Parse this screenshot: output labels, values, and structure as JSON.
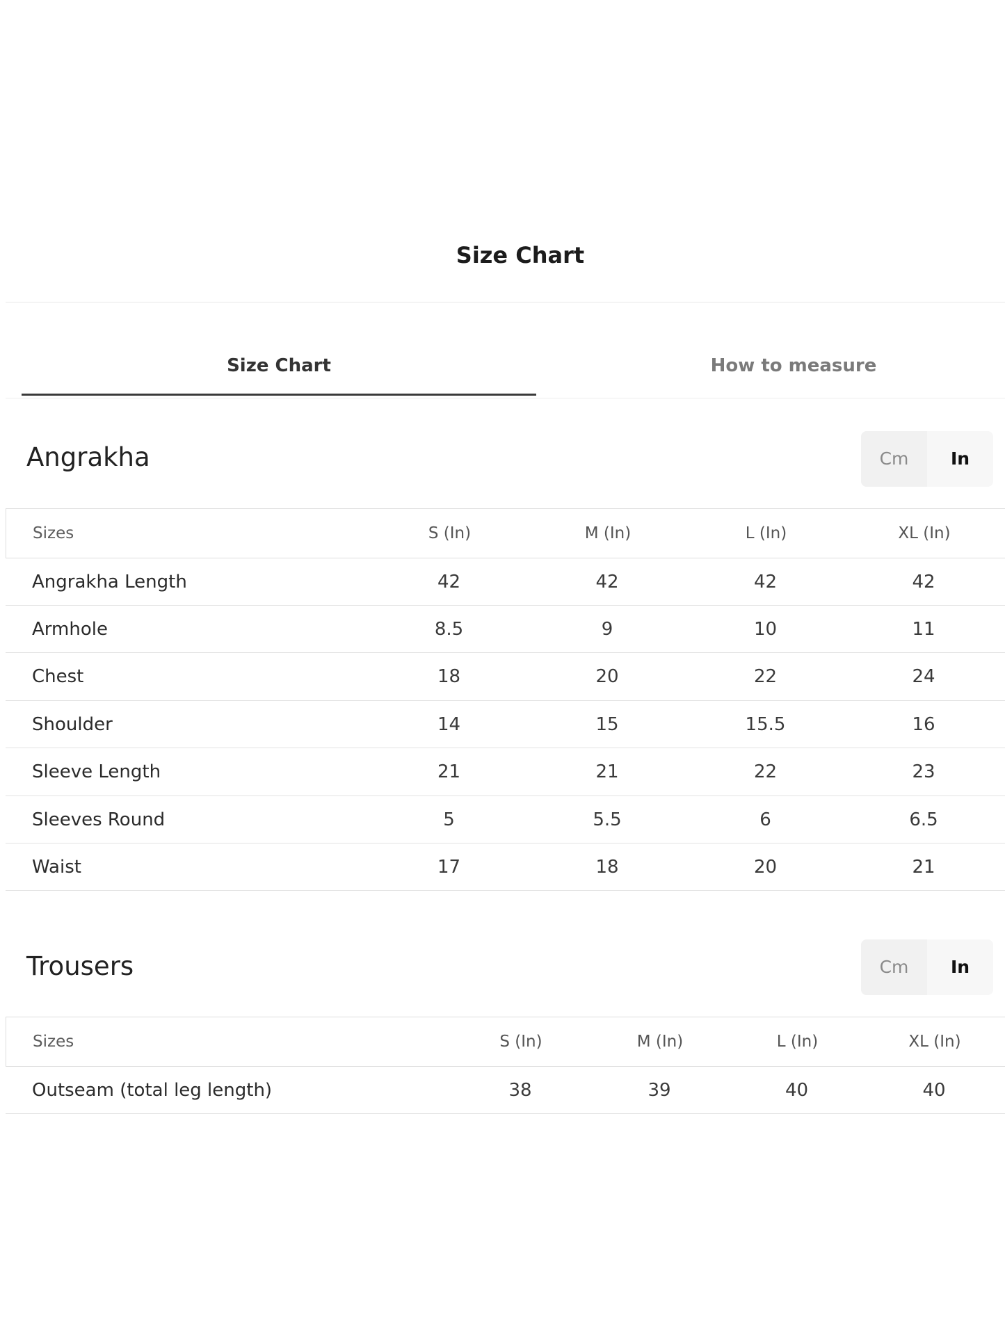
{
  "modal": {
    "title": "Size Chart"
  },
  "tabs": [
    {
      "label": "Size Chart",
      "active": true
    },
    {
      "label": "How to measure",
      "active": false
    }
  ],
  "sections": [
    {
      "title": "Angrakha",
      "units": {
        "cm": "Cm",
        "in": "In",
        "selected": "In"
      },
      "table": {
        "headers": [
          "Sizes",
          "S (In)",
          "M (In)",
          "L (In)",
          "XL (In)"
        ],
        "rows": [
          [
            "Angrakha Length",
            "42",
            "42",
            "42",
            "42"
          ],
          [
            "Armhole",
            "8.5",
            "9",
            "10",
            "11"
          ],
          [
            "Chest",
            "18",
            "20",
            "22",
            "24"
          ],
          [
            "Shoulder",
            "14",
            "15",
            "15.5",
            "16"
          ],
          [
            "Sleeve Length",
            "21",
            "21",
            "22",
            "23"
          ],
          [
            "Sleeves Round",
            "5",
            "5.5",
            "6",
            "6.5"
          ],
          [
            "Waist",
            "17",
            "18",
            "20",
            "21"
          ]
        ]
      }
    },
    {
      "title": "Trousers",
      "units": {
        "cm": "Cm",
        "in": "In",
        "selected": "In"
      },
      "table": {
        "headers": [
          "Sizes",
          "S (In)",
          "M (In)",
          "L (In)",
          "XL (In)"
        ],
        "rows": [
          [
            "Outseam (total leg length)",
            "38",
            "39",
            "40",
            "40"
          ]
        ]
      }
    }
  ],
  "colors": {
    "active_tab_underline": "#3a3a3a",
    "divider": "#e2e2e2",
    "toggle_bg": "#f5f5f5"
  }
}
